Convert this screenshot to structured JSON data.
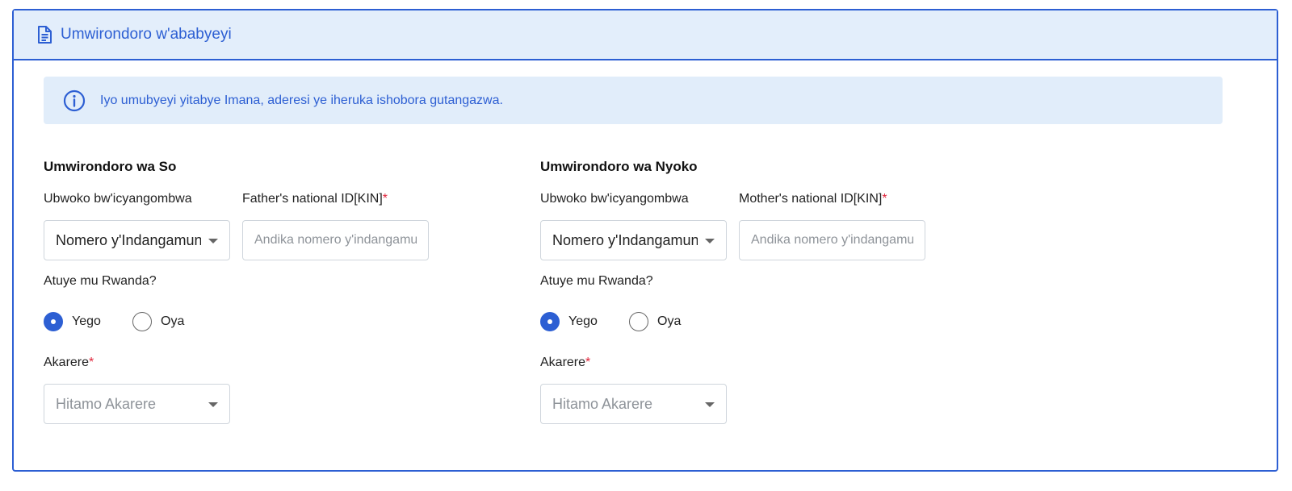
{
  "header": {
    "title": "Umwirondoro w'ababyeyi",
    "icon": "document-icon"
  },
  "alert": {
    "text": "Iyo umubyeyi yitabye Imana, aderesi ye iheruka ishobora gutangazwa.",
    "icon": "info-icon"
  },
  "father": {
    "section_title": "Umwirondoro wa So",
    "doc_type_label": "Ubwoko bw'icyangombwa",
    "doc_type_value": "Nomero y'Indangamuntu",
    "id_label": "Father's national ID[KIN]",
    "id_required": "*",
    "id_placeholder": "Andika nomero y'indangamuntu",
    "resident_label": "Atuye mu Rwanda?",
    "yes": "Yego",
    "no": "Oya",
    "selected": "yes",
    "district_label": "Akarere",
    "district_required": "*",
    "district_placeholder": "Hitamo Akarere"
  },
  "mother": {
    "section_title": "Umwirondoro wa Nyoko",
    "doc_type_label": "Ubwoko bw'icyangombwa",
    "doc_type_value": "Nomero y'Indangamuntu",
    "id_label": "Mother's national ID[KIN]",
    "id_required": "*",
    "id_placeholder": "Andika nomero y'indangamuntu",
    "resident_label": "Atuye mu Rwanda?",
    "yes": "Yego",
    "no": "Oya",
    "selected": "yes",
    "district_label": "Akarere",
    "district_required": "*",
    "district_placeholder": "Hitamo Akarere"
  },
  "colors": {
    "accent": "#2d5fd3",
    "header_bg": "#e3eefb",
    "alert_bg": "#e1edfa",
    "required": "#e0263c"
  }
}
